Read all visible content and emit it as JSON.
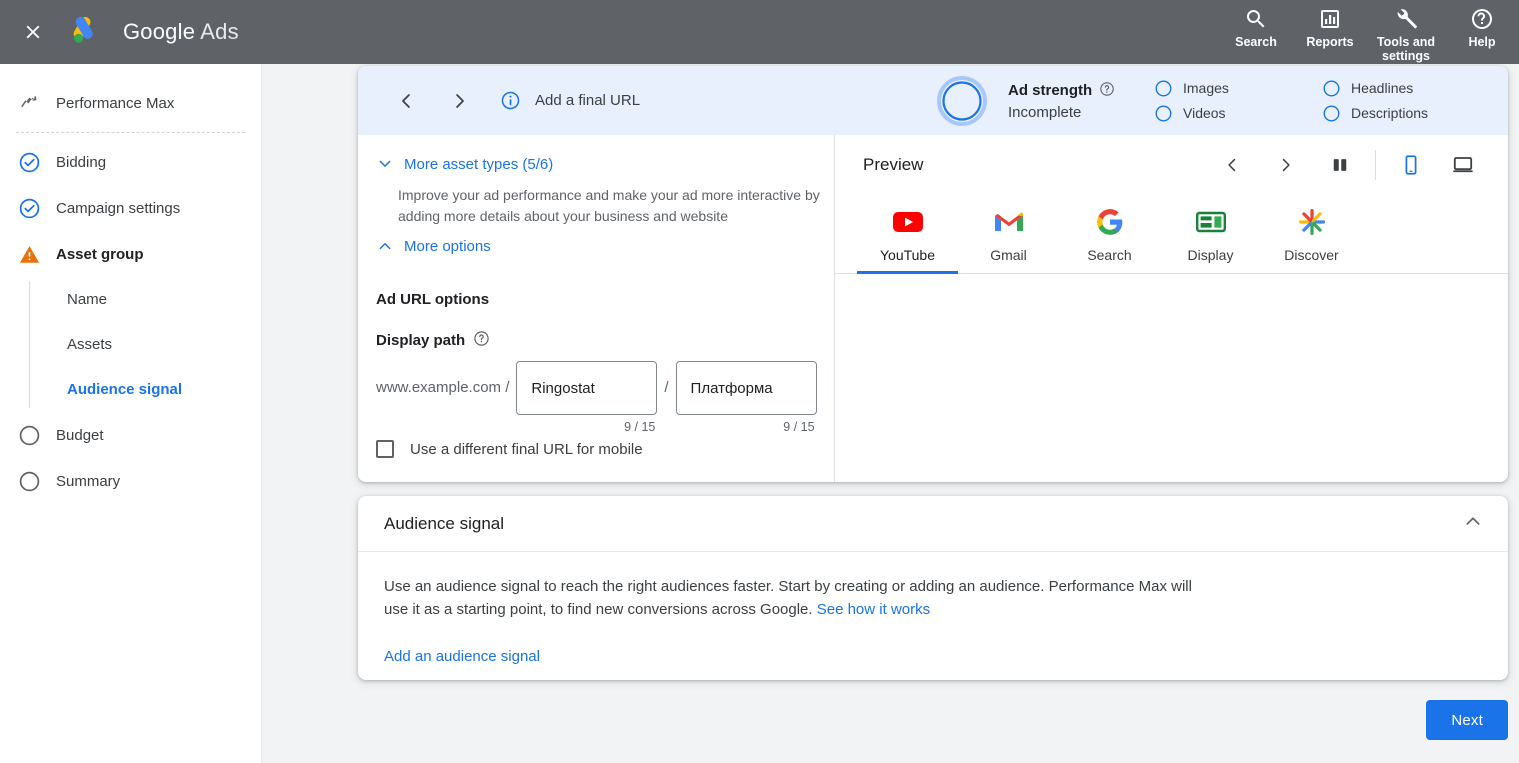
{
  "appbar": {
    "close_icon": "close-icon",
    "logo_icon": "google-ads-logo",
    "brand_google": "Google",
    "brand_ads": "Ads",
    "actions": [
      {
        "icon": "search-icon",
        "label": "Search"
      },
      {
        "icon": "reports-icon",
        "label": "Reports"
      },
      {
        "icon": "wrench-icon",
        "label": "Tools and settings"
      },
      {
        "icon": "help-icon",
        "label": "Help"
      }
    ]
  },
  "sidebar": {
    "items": [
      {
        "icon": "trend-line-icon",
        "label": "Performance Max",
        "state": "current"
      },
      {
        "icon": "check-circle-icon",
        "label": "Bidding",
        "state": "done"
      },
      {
        "icon": "check-circle-icon",
        "label": "Campaign settings",
        "state": "done"
      },
      {
        "icon": "warning-icon",
        "label": "Asset group",
        "state": "warning"
      },
      {
        "icon": "empty-circle-icon",
        "label": "Budget",
        "state": "todo"
      },
      {
        "icon": "empty-circle-icon",
        "label": "Summary",
        "state": "todo"
      }
    ],
    "sub_items": [
      {
        "label": "Name",
        "active": false
      },
      {
        "label": "Assets",
        "active": false
      },
      {
        "label": "Audience signal",
        "active": true
      }
    ]
  },
  "strength": {
    "prev_icon": "chevron-left-icon",
    "next_icon": "chevron-right-icon",
    "info_icon": "info-icon",
    "final_url_text": "Add a final URL",
    "ring_icon": "ad-strength-ring",
    "title": "Ad strength",
    "title_help_icon": "help-circle-icon",
    "status": "Incomplete",
    "checks_col1": [
      {
        "icon": "empty-ring-icon",
        "label": "Images"
      },
      {
        "icon": "empty-ring-icon",
        "label": "Videos"
      }
    ],
    "checks_col2": [
      {
        "icon": "empty-ring-icon",
        "label": "Headlines"
      },
      {
        "icon": "empty-ring-icon",
        "label": "Descriptions"
      }
    ]
  },
  "form": {
    "more_asset_types_label": "More asset types (5/6)",
    "more_asset_types_icon": "chevron-down-icon",
    "helper_text": "Improve your ad performance and make your ad more interactive by adding more details about your business and website",
    "more_options_label": "More options",
    "more_options_icon": "chevron-up-icon",
    "ad_url_options_label": "Ad URL options",
    "display_path_label": "Display path",
    "display_path_help_icon": "help-circle-icon",
    "url_prefix": "www.example.com /",
    "path_separator": "/",
    "path1_value": "Ringostat",
    "path1_counter": "9 / 15",
    "path2_value": "Платформа",
    "path2_counter": "9 / 15",
    "mobile_url_checkbox_label": "Use a different final URL for mobile",
    "mobile_url_checked": false
  },
  "preview": {
    "title": "Preview",
    "prev_icon": "chevron-left-icon",
    "next_icon": "chevron-right-icon",
    "split_icon": "split-view-icon",
    "mobile_icon": "mobile-device-icon",
    "desktop_icon": "desktop-device-icon",
    "active_device": "mobile",
    "tabs": [
      {
        "icon": "youtube-icon",
        "label": "YouTube",
        "active": true
      },
      {
        "icon": "gmail-icon",
        "label": "Gmail",
        "active": false
      },
      {
        "icon": "google-g-icon",
        "label": "Search",
        "active": false
      },
      {
        "icon": "display-icon",
        "label": "Display",
        "active": false
      },
      {
        "icon": "discover-icon",
        "label": "Discover",
        "active": false
      }
    ]
  },
  "audience": {
    "title": "Audience signal",
    "collapse_icon": "chevron-up-icon",
    "body_part1": "Use an audience signal to reach the right audiences faster. Start by creating or adding an audience. Performance Max will use it as a starting point, to find new conversions across Google.",
    "body_link": "See how it works",
    "add_link": "Add an audience signal"
  },
  "footer": {
    "next_label": "Next"
  },
  "colors": {
    "appbar_bg": "#5f6368",
    "accent_blue": "#1a73e8",
    "banner_bg": "#e8f0fe",
    "warning_orange": "#e8710a",
    "page_bg": "#f1f3f4"
  }
}
